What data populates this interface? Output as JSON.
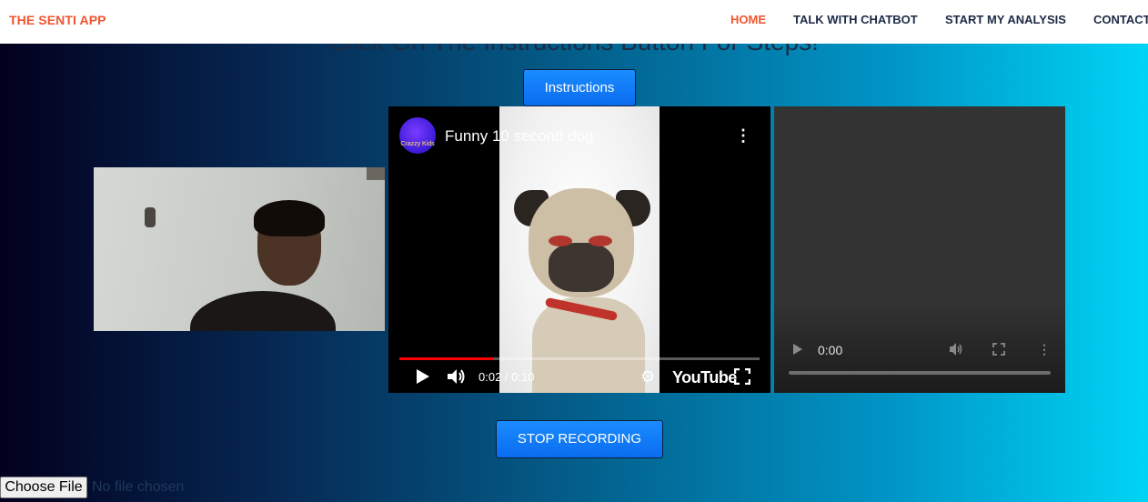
{
  "navbar": {
    "brand": "THE SENTI APP",
    "links": [
      {
        "label": "HOME",
        "active": true
      },
      {
        "label": "TALK WITH CHATBOT",
        "active": false
      },
      {
        "label": "START MY ANALYSIS",
        "active": false
      },
      {
        "label": "CONTACT",
        "active": false
      }
    ]
  },
  "headline": "Click On The Instructions Button For Steps!",
  "instructions_button": "Instructions",
  "youtube": {
    "title": "Funny 10 second dog",
    "channel_avatar_text": "Crazzy Kids",
    "time": "0:02 / 0:10",
    "progress": 0.26,
    "logo": "YouTube"
  },
  "recorded_video": {
    "time": "0:00"
  },
  "stop_button": "STOP RECORDING",
  "file_input": {
    "button": "Choose File",
    "status": "No file chosen"
  },
  "colors": {
    "brand": "#f0542d",
    "nav_text": "#1b2a45",
    "button": "#0a6cf0",
    "yt_progress": "#ff0000"
  }
}
